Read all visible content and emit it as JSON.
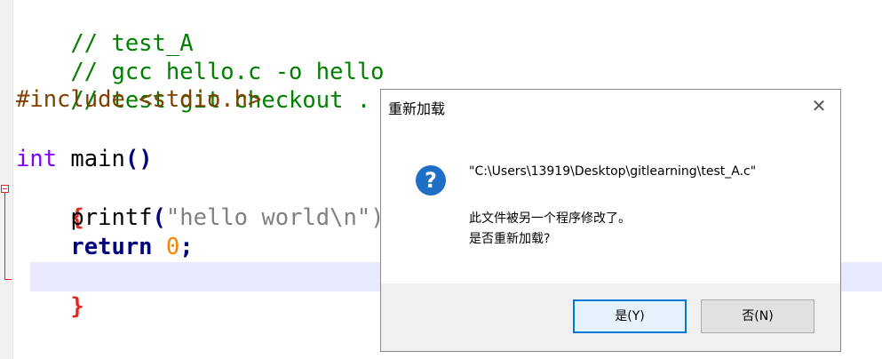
{
  "editor": {
    "lines": {
      "l1": "// test_A",
      "l2": "// gcc hello.c -o hello",
      "l3": "// test git checkout .",
      "l4_directive": "#include",
      "l4_header": "<stdio.h>",
      "l6_type": "int",
      "l6_name": "main",
      "l6_parens": "()",
      "l7_brace": "{",
      "l8_fn": "printf",
      "l8_paren": "(",
      "l8_str": "\"hello world\\n\");",
      "l9_kw": "return",
      "l9_num": "0",
      "l9_semi": ";",
      "l10_brace": "}"
    },
    "colors": {
      "comment": "#008000",
      "preprocessor": "#804000",
      "type": "#8000ff",
      "keyword": "#000080",
      "brace": "#e0271f",
      "string": "#808080",
      "number": "#ff8000",
      "current_line": "#e8e8ff"
    }
  },
  "dialog": {
    "title": "重新加载",
    "close_glyph": "✕",
    "icon_glyph": "?",
    "file_path": "\"C:\\Users\\13919\\Desktop\\gitlearning\\test_A.c\"",
    "message_line1": "此文件被另一个程序修改了。",
    "message_line2": "是否重新加载?",
    "yes_label": "是(Y)",
    "no_label": "否(N)",
    "accent": "#0078d7",
    "icon_color": "#1f6fc6"
  }
}
